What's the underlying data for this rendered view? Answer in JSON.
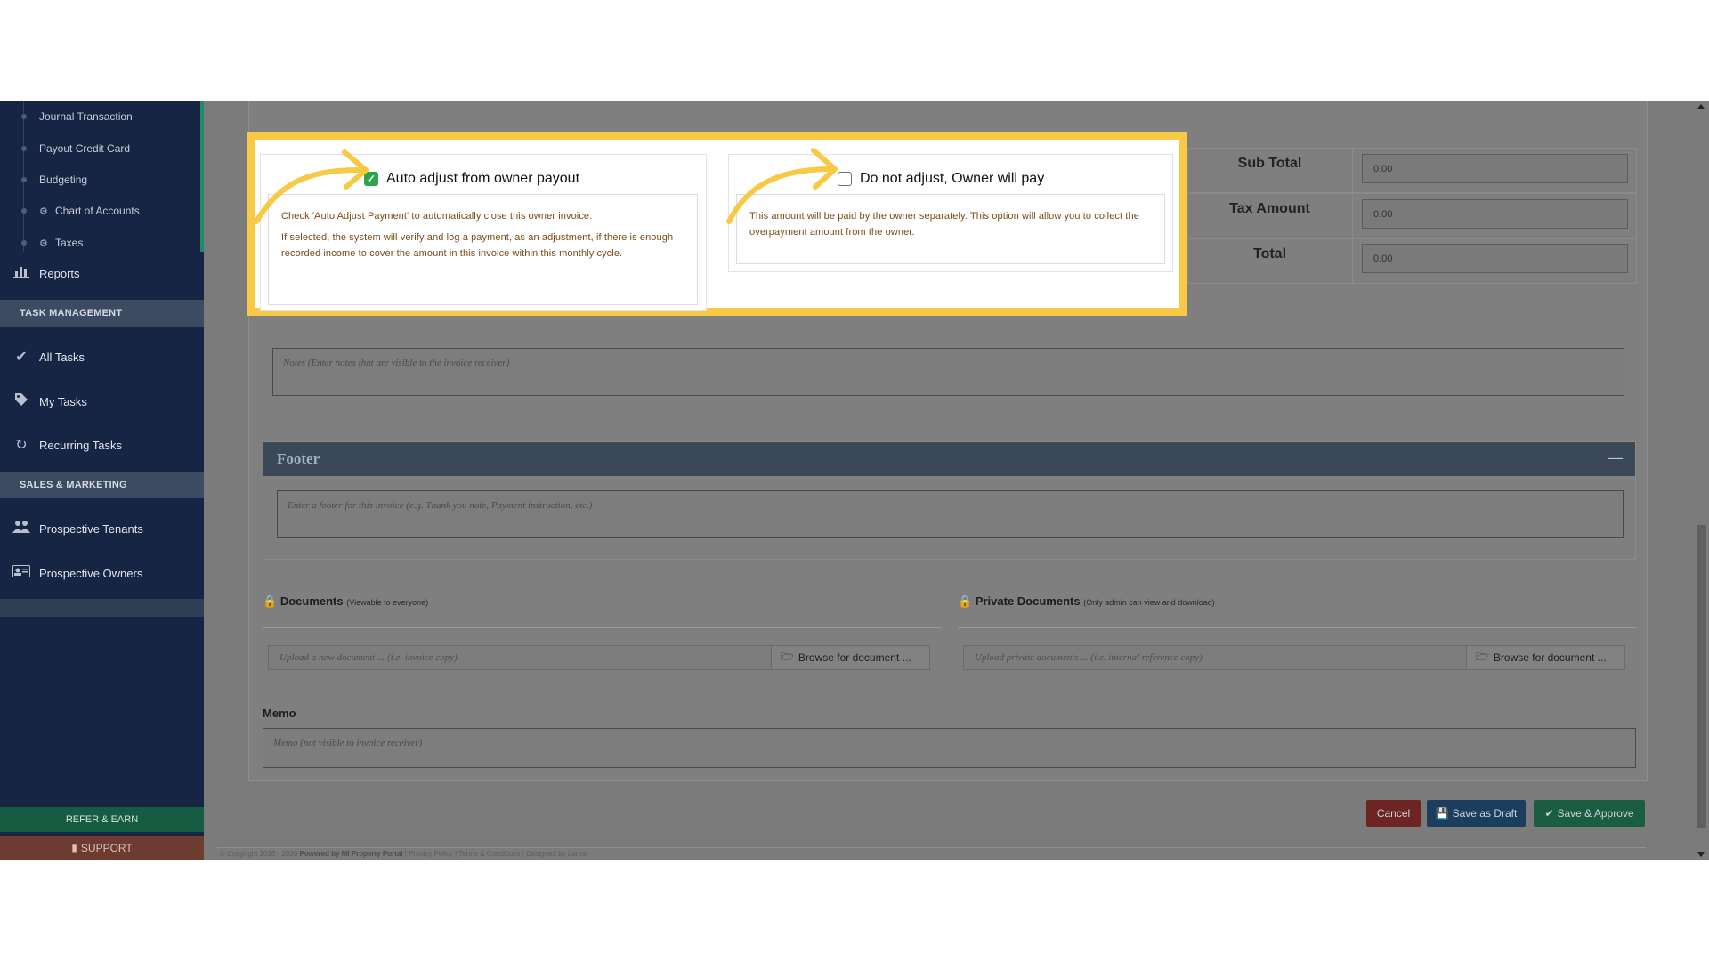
{
  "sidebar": {
    "sub_items": [
      {
        "label": "Journal Transaction",
        "icon": ""
      },
      {
        "label": "Payout Credit Card",
        "icon": ""
      },
      {
        "label": "Budgeting",
        "icon": ""
      },
      {
        "label": "Chart of Accounts",
        "icon": "gear-icon"
      },
      {
        "label": "Taxes",
        "icon": "gear-icon"
      }
    ],
    "reports": "Reports",
    "task_management_head": "TASK MANAGEMENT",
    "all_tasks": "All Tasks",
    "my_tasks": "My Tasks",
    "recurring_tasks": "Recurring Tasks",
    "sales_marketing_head": "SALES & MARKETING",
    "prospective_tenants": "Prospective Tenants",
    "prospective_owners": "Prospective Owners",
    "refer_earn": "REFER & EARN",
    "support": "SUPPORT"
  },
  "totals": {
    "sub_total_label": "Sub Total",
    "sub_total_value": "0.00",
    "tax_amount_label": "Tax Amount",
    "tax_amount_value": "0.00",
    "total_label": "Total",
    "total_value": "0.00"
  },
  "options": {
    "auto_adjust": {
      "title": "Auto adjust from owner payout",
      "checked": true,
      "desc1": "Check 'Auto Adjust Payment' to automatically close this owner invoice.",
      "desc2": "If selected, the system will verify and log a payment, as an adjustment, if there is enough recorded income to cover the amount in this invoice within this monthly cycle."
    },
    "no_adjust": {
      "title": "Do not adjust, Owner will pay",
      "checked": false,
      "desc1": "This amount will be paid by the owner separately. This option will allow you to collect the overpayment amount from the owner."
    }
  },
  "notes_placeholder": "Notes (Enter notes that are visible to the invoice receiver)",
  "footer": {
    "title": "Footer",
    "collapse": "—",
    "placeholder": "Enter a footer for this invoice (e.g. Thank you note, Payment instruction, etc.)"
  },
  "documents": {
    "title": "Documents",
    "subtitle": "(Viewable to everyone)",
    "placeholder": "Upload a new document ... (i.e. invoice copy)",
    "browse": "Browse for document ..."
  },
  "private_documents": {
    "title": "Private Documents",
    "subtitle": "(Only admin can view and download)",
    "placeholder": "Upload private documents ... (i.e. internal reference copy)",
    "browse": "Browse for document ..."
  },
  "memo": {
    "label": "Memo",
    "placeholder": "Memo (not visible to invoice receiver)"
  },
  "buttons": {
    "cancel": "Cancel",
    "save_draft": "Save as Draft",
    "save_approve": "Save & Approve"
  },
  "copyright": {
    "prefix": "© Copyright 2016 - 2020",
    "powered": "Powered by MI Property Portal",
    "links": "| Privacy Policy | Terms & Conditions",
    "suffix": "| Designed by Lanna"
  },
  "colors": {
    "sidebar_bg": "#162544",
    "highlight_border": "#f7c945",
    "checkbox_on": "#2ea44f",
    "arrow": "#f7c945",
    "cancel": "#6d2423",
    "draft": "#1c3e5e",
    "approve": "#1a5d43"
  }
}
